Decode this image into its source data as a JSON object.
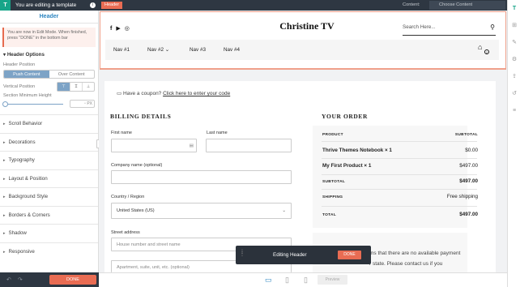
{
  "topbar": {
    "logo": "T",
    "title": "You are editing a template",
    "info_icon": "info-icon"
  },
  "panel": {
    "title": "Header",
    "notice": "You are now in Edit Mode. When finished, press \"DONE\" in the bottom bar",
    "options_title": "Header Options",
    "position_label": "Header Position",
    "position_options": [
      "Push Content",
      "Over Content"
    ],
    "position_selected": "Push Content",
    "vertical_label": "Vertical Position",
    "vertical_opts": [
      "⊤",
      "Ɪ",
      "⊥"
    ],
    "section_height_label": "Section Minimum Height",
    "section_height_unit": "PX",
    "section_height_value": 0,
    "accordion": [
      "Scroll Behavior",
      "Decorations",
      "Typography",
      "Layout & Position",
      "Background Style",
      "Borders & Corners",
      "Shadow",
      "Responsive"
    ],
    "done": "DONE"
  },
  "editor": {
    "tag": "Header",
    "content_label": "Content:",
    "content_select": "Choose Content",
    "preview": "Preview",
    "editing": "Editing Header",
    "editing_done": "DONE"
  },
  "site": {
    "brand": "Christine TV",
    "social": [
      "f",
      "▶",
      "◎"
    ],
    "search_placeholder": "Search Here...",
    "nav": [
      "Nav #1",
      "Nav #2",
      "Nav #3",
      "Nav #4"
    ],
    "cart_count": "2"
  },
  "checkout": {
    "coupon_text": "Have a coupon? ",
    "coupon_link": "Click here to enter your code",
    "billing_title": "BILLING DETAILS",
    "first_name": "First name",
    "last_name": "Last name",
    "company": "Company name (optional)",
    "country_label": "Country / Region",
    "country_value": "United States (US)",
    "street_label": "Street address",
    "street_placeholder": "House number and street name",
    "street2_placeholder": "Apartment, suite, unit, etc. (optional)",
    "order_title": "YOUR ORDER",
    "col_product": "PRODUCT",
    "col_subtotal": "SUBTOTAL",
    "items": [
      {
        "name": "Thrive Themes Notebook  × 1",
        "price": "$0.00"
      },
      {
        "name": "My First Product  × 1",
        "price": "$497.00"
      }
    ],
    "subtotal_label": "SUBTOTAL",
    "subtotal_value": "$497.00",
    "shipping_label": "SHIPPING",
    "shipping_value": "Free shipping",
    "total_label": "TOTAL",
    "total_value": "$497.00",
    "notice_line1": "ms that there are no available payment",
    "notice_line2": "r state. Please contact us if you"
  },
  "colors": {
    "accent": "#e96c53",
    "blue": "#2e86c1",
    "dark": "#2e3742"
  }
}
